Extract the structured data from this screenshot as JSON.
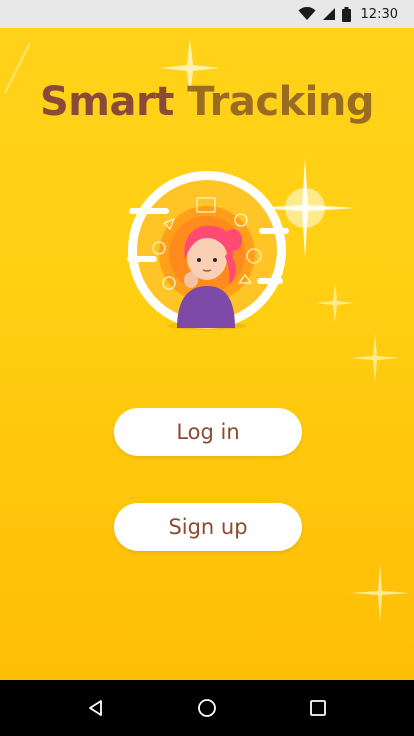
{
  "status_bar": {
    "time": "12:30",
    "icons": [
      "wifi-icon",
      "signal-icon",
      "battery-icon"
    ]
  },
  "app": {
    "title_part1": "Smart",
    "title_part2": "Tracking"
  },
  "buttons": {
    "login_label": "Log in",
    "signup_label": "Sign up"
  },
  "nav_bar": {
    "icons": [
      "back-icon",
      "home-icon",
      "recents-icon"
    ]
  },
  "colors": {
    "background_top": "#ffd21a",
    "background_bottom": "#ffbe06",
    "title_smart": "#8a4a3a",
    "title_tracking": "#9a6c22",
    "button_text": "#8b4a31",
    "button_bg": "#ffffff"
  }
}
